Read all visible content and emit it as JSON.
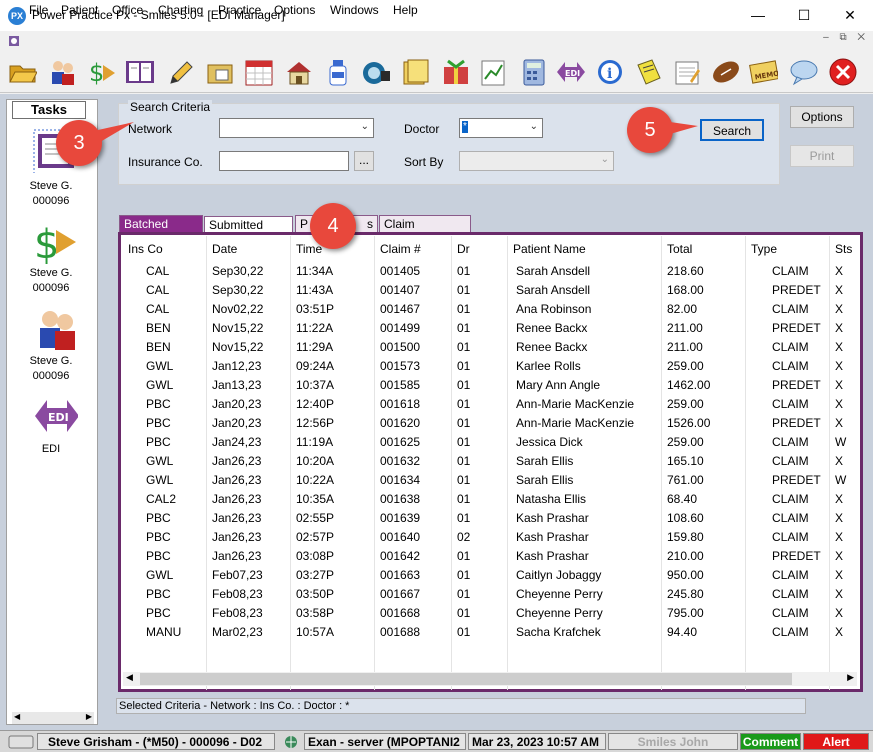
{
  "window": {
    "title": "Power Practice Px - Smiles 5.0 - [EDI Manager]",
    "app_icon_text": "PX",
    "minimize": "—",
    "maximize": "☐",
    "close": "✕"
  },
  "menu": [
    "File",
    "Patient",
    "Office",
    "Charting",
    "Practice",
    "Options",
    "Windows",
    "Help"
  ],
  "tasks": {
    "header": "Tasks",
    "items": [
      {
        "name": "Steve G.",
        "id": "000096"
      },
      {
        "name": "Steve G.",
        "id": "000096"
      },
      {
        "name": "Steve G.",
        "id": "000096"
      },
      {
        "name": "EDI"
      }
    ]
  },
  "search_criteria": {
    "legend": "Search Criteria",
    "network_label": "Network",
    "network_value": "",
    "doctor_label": "Doctor",
    "doctor_value": "*",
    "insurance_label": "Insurance Co.",
    "insurance_value": "",
    "browse_label": "...",
    "sortby_label": "Sort By",
    "sortby_value": "",
    "search_button": "Search",
    "options_button": "Options",
    "print_button": "Print"
  },
  "callouts": [
    "3",
    "4",
    "5"
  ],
  "tabs": [
    "Batched Claims",
    "Submitted Claims",
    "P",
    "s",
    "Claim Responses"
  ],
  "table": {
    "columns": [
      "Ins Co",
      "Date",
      "Time",
      "Claim #",
      "Dr",
      "Patient Name",
      "Total",
      "Type",
      "Sts"
    ],
    "rows": [
      [
        "CAL",
        "Sep30,22",
        "11:34A",
        "001405",
        "01",
        "Sarah Ansdell",
        "218.60",
        "CLAIM",
        "X"
      ],
      [
        "CAL",
        "Sep30,22",
        "11:43A",
        "001407",
        "01",
        "Sarah Ansdell",
        "168.00",
        "PREDET",
        "X"
      ],
      [
        "CAL",
        "Nov02,22",
        "03:51P",
        "001467",
        "01",
        "Ana Robinson",
        "82.00",
        "CLAIM",
        "X"
      ],
      [
        "BEN",
        "Nov15,22",
        "11:22A",
        "001499",
        "01",
        "Renee Backx",
        "211.00",
        "PREDET",
        "X"
      ],
      [
        "BEN",
        "Nov15,22",
        "11:29A",
        "001500",
        "01",
        "Renee Backx",
        "211.00",
        "CLAIM",
        "X"
      ],
      [
        "GWL",
        "Jan12,23",
        "09:24A",
        "001573",
        "01",
        "Karlee Rolls",
        "259.00",
        "CLAIM",
        "X"
      ],
      [
        "GWL",
        "Jan13,23",
        "10:37A",
        "001585",
        "01",
        "Mary Ann Angle",
        "1462.00",
        "PREDET",
        "X"
      ],
      [
        "PBC",
        "Jan20,23",
        "12:40P",
        "001618",
        "01",
        "Ann-Marie MacKenzie",
        "259.00",
        "CLAIM",
        "X"
      ],
      [
        "PBC",
        "Jan20,23",
        "12:56P",
        "001620",
        "01",
        "Ann-Marie MacKenzie",
        "1526.00",
        "PREDET",
        "X"
      ],
      [
        "PBC",
        "Jan24,23",
        "11:19A",
        "001625",
        "01",
        "Jessica Dick",
        "259.00",
        "CLAIM",
        "W"
      ],
      [
        "GWL",
        "Jan26,23",
        "10:20A",
        "001632",
        "01",
        "Sarah Ellis",
        "165.10",
        "CLAIM",
        "X"
      ],
      [
        "GWL",
        "Jan26,23",
        "10:22A",
        "001634",
        "01",
        "Sarah Ellis",
        "761.00",
        "PREDET",
        "W"
      ],
      [
        "CAL2",
        "Jan26,23",
        "10:35A",
        "001638",
        "01",
        "Natasha Ellis",
        "68.40",
        "CLAIM",
        "X"
      ],
      [
        "PBC",
        "Jan26,23",
        "02:55P",
        "001639",
        "01",
        "Kash Prashar",
        "108.60",
        "CLAIM",
        "X"
      ],
      [
        "PBC",
        "Jan26,23",
        "02:57P",
        "001640",
        "02",
        "Kash Prashar",
        "159.80",
        "CLAIM",
        "X"
      ],
      [
        "PBC",
        "Jan26,23",
        "03:08P",
        "001642",
        "01",
        "Kash Prashar",
        "210.00",
        "PREDET",
        "X"
      ],
      [
        "GWL",
        "Feb07,23",
        "03:27P",
        "001663",
        "01",
        "Caitlyn Jobaggy",
        "950.00",
        "CLAIM",
        "X"
      ],
      [
        "PBC",
        "Feb08,23",
        "03:50P",
        "001667",
        "01",
        "Cheyenne Perry",
        "245.80",
        "CLAIM",
        "X"
      ],
      [
        "PBC",
        "Feb08,23",
        "03:58P",
        "001668",
        "01",
        "Cheyenne Perry",
        "795.00",
        "CLAIM",
        "X"
      ],
      [
        "MANU",
        "Mar02,23",
        "10:57A",
        "001688",
        "01",
        "Sacha Krafchek",
        "94.40",
        "CLAIM",
        "X"
      ]
    ]
  },
  "selected_criteria": "Selected Criteria - Network :   Ins Co. :   Doctor : *",
  "status": {
    "user": "Steve Grisham - (*M50) - 000096 - D02",
    "server": "Exan - server (MPOPTANI2",
    "datetime": "Mar 23, 2023 10:57 AM",
    "provider": "Smiles John",
    "comment": "Comment",
    "alert": "Alert"
  },
  "colors": {
    "accent_tab": "#8a2a8a",
    "callout": "#e8483c",
    "comment": "#1a9a1a",
    "alert": "#e01818"
  },
  "icons": [
    "open-folder-icon",
    "patients-icon",
    "money-icon",
    "book-icon",
    "pencil-icon",
    "file-icon",
    "calendar-icon",
    "house-icon",
    "bottle-icon",
    "camera-icon",
    "folder-icon",
    "gift-icon",
    "chart-icon",
    "calculator-icon",
    "edi-icon",
    "info-icon",
    "note-icon",
    "notepad-icon",
    "football-icon",
    "memo-icon",
    "chat-icon",
    "close-app-icon"
  ]
}
